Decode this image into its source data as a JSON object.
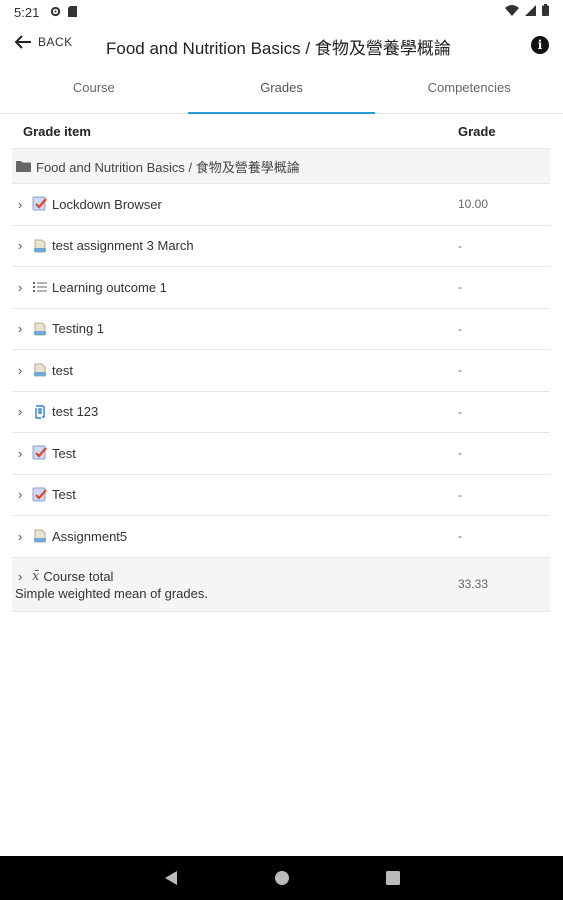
{
  "status_bar": {
    "time": "5:21"
  },
  "app_bar": {
    "back_label": "BACK",
    "title": "Food and Nutrition Basics / 食物及營養學概論",
    "info_symbol": "i"
  },
  "tabs": [
    {
      "label": "Course"
    },
    {
      "label": "Grades"
    },
    {
      "label": "Competencies"
    }
  ],
  "active_tab": "Grades",
  "table": {
    "headers": {
      "item": "Grade item",
      "grade": "Grade"
    },
    "category": "Food and Nutrition Basics / 食物及營養學概論",
    "rows": [
      {
        "name": "Lockdown Browser",
        "grade": "10.00",
        "icon": "quiz-icon"
      },
      {
        "name": "test assignment 3 March",
        "grade": "-",
        "icon": "assignment-icon"
      },
      {
        "name": "Learning outcome 1",
        "grade": "-",
        "icon": "outcome-list-icon"
      },
      {
        "name": "Testing 1",
        "grade": "-",
        "icon": "assignment-icon"
      },
      {
        "name": "test",
        "grade": "-",
        "icon": "assignment-icon"
      },
      {
        "name": "test 123",
        "grade": "-",
        "icon": "h5p-icon"
      },
      {
        "name": "Test",
        "grade": "-",
        "icon": "quiz-icon"
      },
      {
        "name": "Test",
        "grade": "-",
        "icon": "quiz-icon"
      },
      {
        "name": "Assignment5",
        "grade": "-",
        "icon": "assignment-icon"
      }
    ],
    "total": {
      "name": "Course total",
      "description": "Simple weighted mean of grades.",
      "grade": "33.33",
      "symbol": "x̄"
    }
  },
  "colors": {
    "accent": "#2a9bd6",
    "row_alt_bg": "#f4f5f7",
    "nav_bg": "#000000"
  }
}
